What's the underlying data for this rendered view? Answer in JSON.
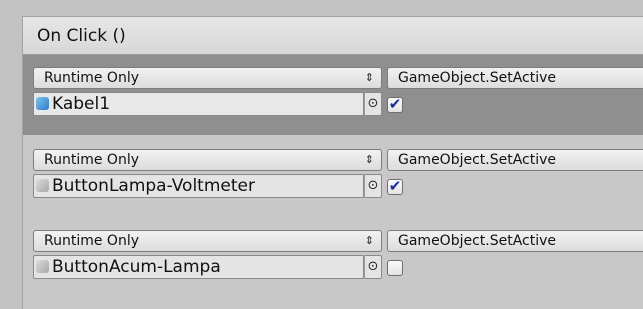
{
  "header": {
    "title": "On Click ()"
  },
  "entries": [
    {
      "runtime": "Runtime Only",
      "arrows": "⇕",
      "function": "GameObject.SetActive",
      "object": "Kabel1",
      "picker": "⊙",
      "checked": true,
      "check_glyph": "✔"
    },
    {
      "runtime": "Runtime Only",
      "arrows": "⇕",
      "function": "GameObject.SetActive",
      "object": "ButtonLampa-Voltmeter",
      "picker": "⊙",
      "checked": true,
      "check_glyph": "✔"
    },
    {
      "runtime": "Runtime Only",
      "arrows": "⇕",
      "function": "GameObject.SetActive",
      "object": "ButtonAcum-Lampa",
      "picker": "⊙",
      "checked": false,
      "check_glyph": ""
    }
  ],
  "icons": {
    "object_icon_active": "gameobject-cube-icon-blue",
    "object_icon_inactive": "gameobject-cube-icon-gray",
    "picker_icon": "object-picker-icon"
  },
  "colors": {
    "selected_row": "#8f8f8f",
    "check": "#1a2c9a",
    "active_cube": "#2d7cc6"
  }
}
